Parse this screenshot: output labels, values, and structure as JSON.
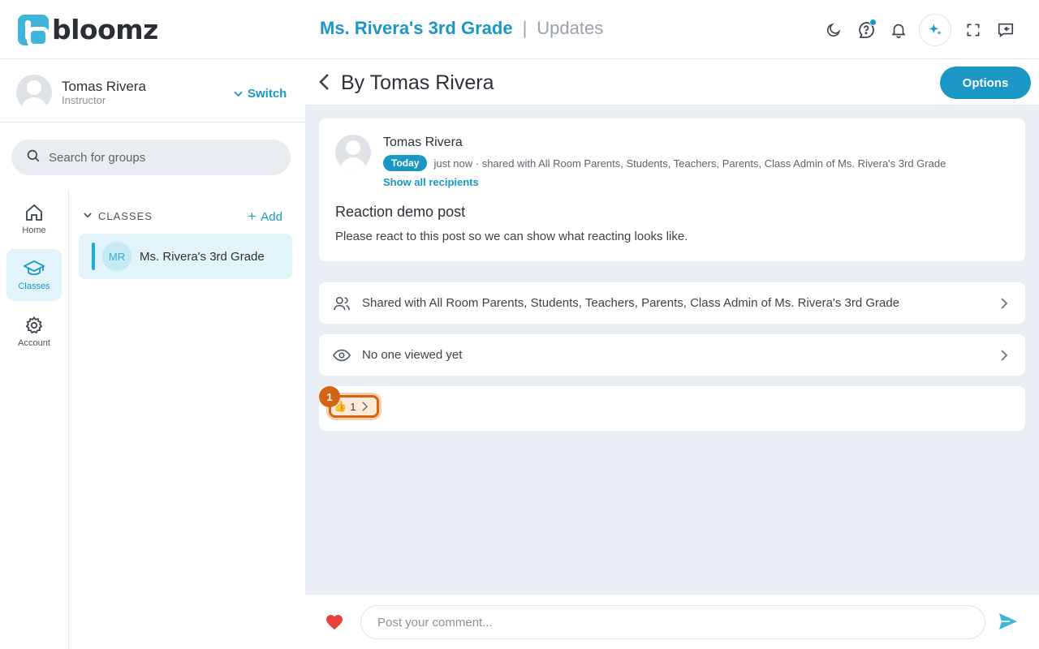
{
  "header": {
    "logo_text": "bloomz",
    "class_name": "Ms. Rivera's 3rd Grade",
    "separator": "|",
    "section": "Updates"
  },
  "icons": {
    "theme": "moon-icon",
    "help": "help-chat-icon",
    "notifications": "bell-icon",
    "ai": "sparkle-icon",
    "fullscreen": "expand-icon",
    "collapse": "collapse-panel-icon"
  },
  "profile": {
    "name": "Tomas Rivera",
    "role": "Instructor",
    "switch_label": "Switch"
  },
  "search": {
    "placeholder": "Search for groups"
  },
  "nav": {
    "items": [
      {
        "label": "Home"
      },
      {
        "label": "Classes"
      },
      {
        "label": "Account"
      }
    ]
  },
  "groups": {
    "section_label": "CLASSES",
    "add_label": "Add",
    "items": [
      {
        "initials": "MR",
        "name": "Ms. Rivera's 3rd Grade"
      }
    ]
  },
  "main": {
    "title": "By Tomas Rivera",
    "options_label": "Options"
  },
  "post": {
    "author": "Tomas Rivera",
    "badge": "Today",
    "meta": "just now · shared with All Room Parents, Students, Teachers, Parents, Class Admin of Ms. Rivera's 3rd Grade",
    "show_all": "Show all recipients",
    "title": "Reaction demo post",
    "body": "Please react to this post so we can show what reacting looks like."
  },
  "shared_row": {
    "text": "Shared with All Room Parents, Students, Teachers, Parents, Class Admin of Ms. Rivera's 3rd Grade"
  },
  "viewed_row": {
    "text": "No one viewed yet"
  },
  "reactions": {
    "emoji": "👍",
    "count": "1",
    "step_number": "1"
  },
  "comment": {
    "placeholder": "Post your comment..."
  },
  "colors": {
    "accent": "#1a97c4",
    "highlight": "#d36413",
    "heart": "#e8403a"
  }
}
